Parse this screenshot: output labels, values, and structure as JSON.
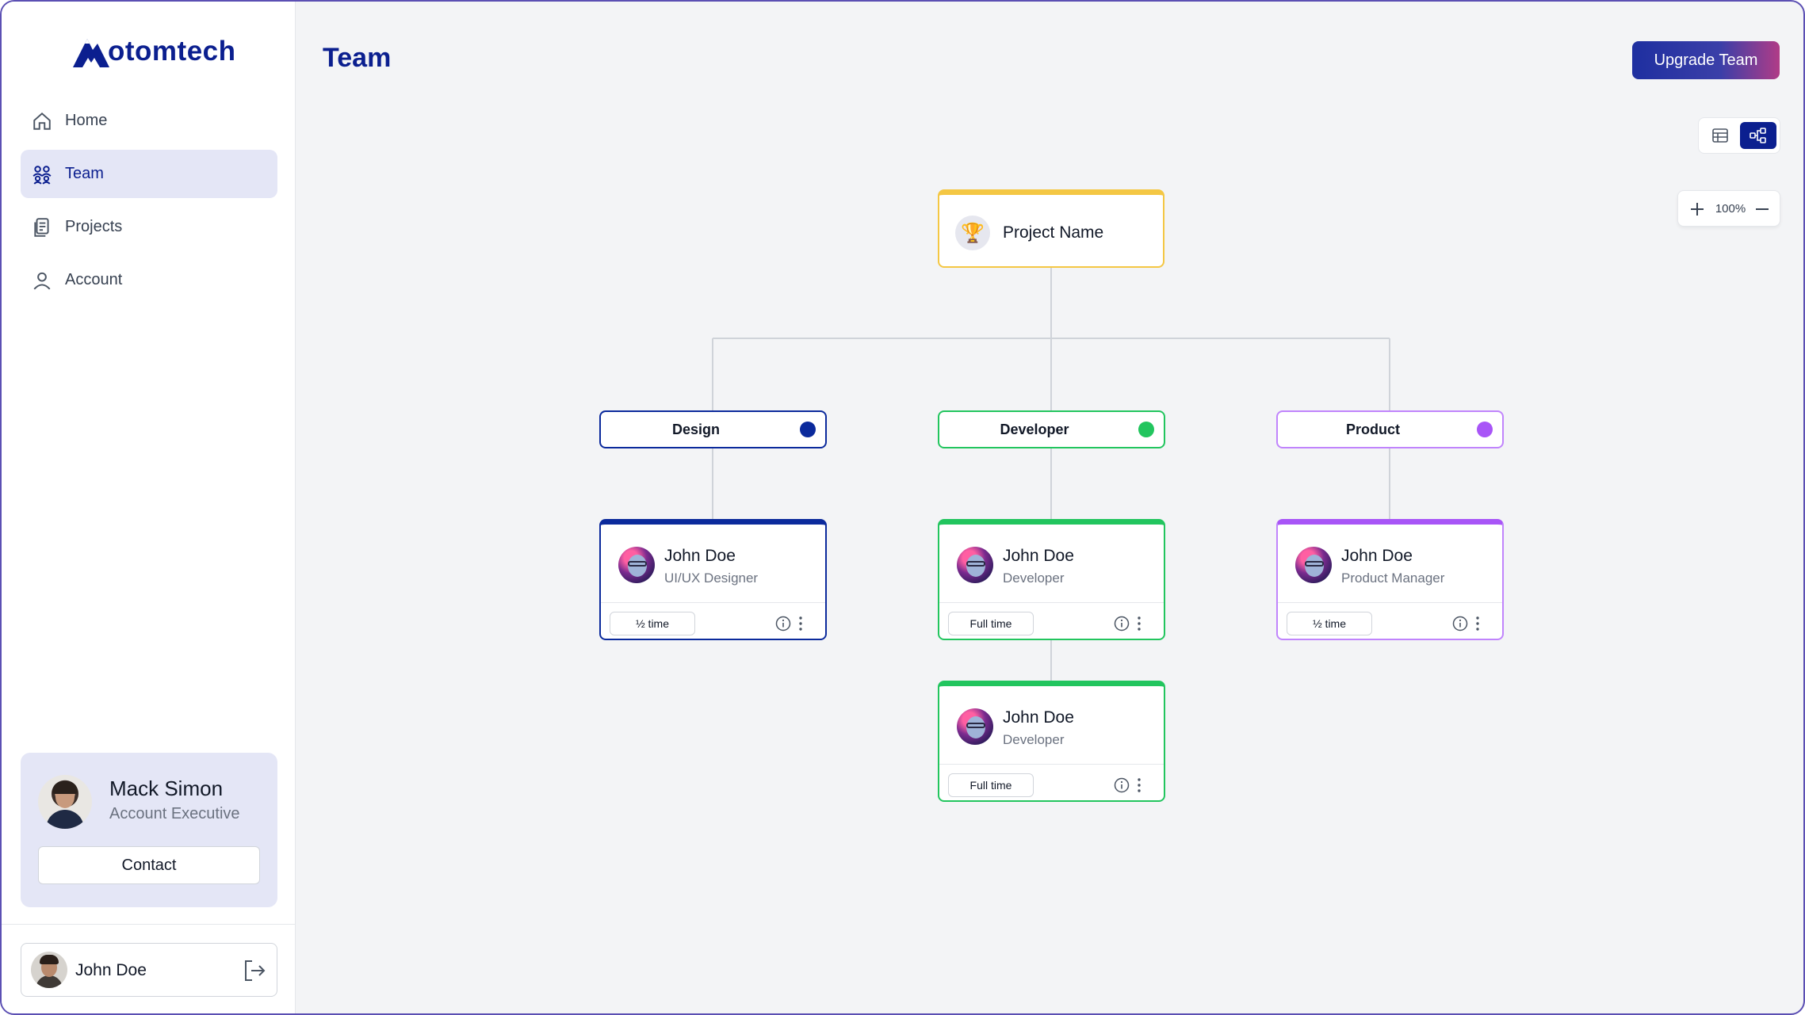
{
  "brand": {
    "name": "otomtech"
  },
  "page": {
    "title": "Team"
  },
  "sidebar": {
    "items": [
      {
        "label": "Home",
        "icon": "home-icon",
        "active": false
      },
      {
        "label": "Team",
        "icon": "team-icon",
        "active": true
      },
      {
        "label": "Projects",
        "icon": "projects-icon",
        "active": false
      },
      {
        "label": "Account",
        "icon": "account-icon",
        "active": false
      }
    ],
    "contact": {
      "name": "Mack Simon",
      "role": "Account Executive",
      "button": "Contact"
    },
    "user": {
      "name": "John Doe"
    }
  },
  "toolbar": {
    "upgrade_label": "Upgrade Team",
    "zoom": "100%"
  },
  "org": {
    "root": {
      "label": "Project Name"
    },
    "departments": [
      {
        "name": "Design",
        "color": "#0b2a9c"
      },
      {
        "name": "Developer",
        "color": "#22c55e"
      },
      {
        "name": "Product",
        "color": "#a855f7"
      }
    ],
    "members": [
      {
        "name": "John Doe",
        "role": "UI/UX Designer",
        "time": "½ time",
        "dept": "Design"
      },
      {
        "name": "John Doe",
        "role": "Developer",
        "time": "Full time",
        "dept": "Developer"
      },
      {
        "name": "John Doe",
        "role": "Product Manager",
        "time": "½ time",
        "dept": "Product"
      },
      {
        "name": "John Doe",
        "role": "Developer",
        "time": "Full time",
        "dept": "Developer"
      }
    ]
  },
  "colors": {
    "accent": "#0b1f8f",
    "root_border": "#f4c744",
    "active_nav_bg": "#e4e6f6"
  }
}
